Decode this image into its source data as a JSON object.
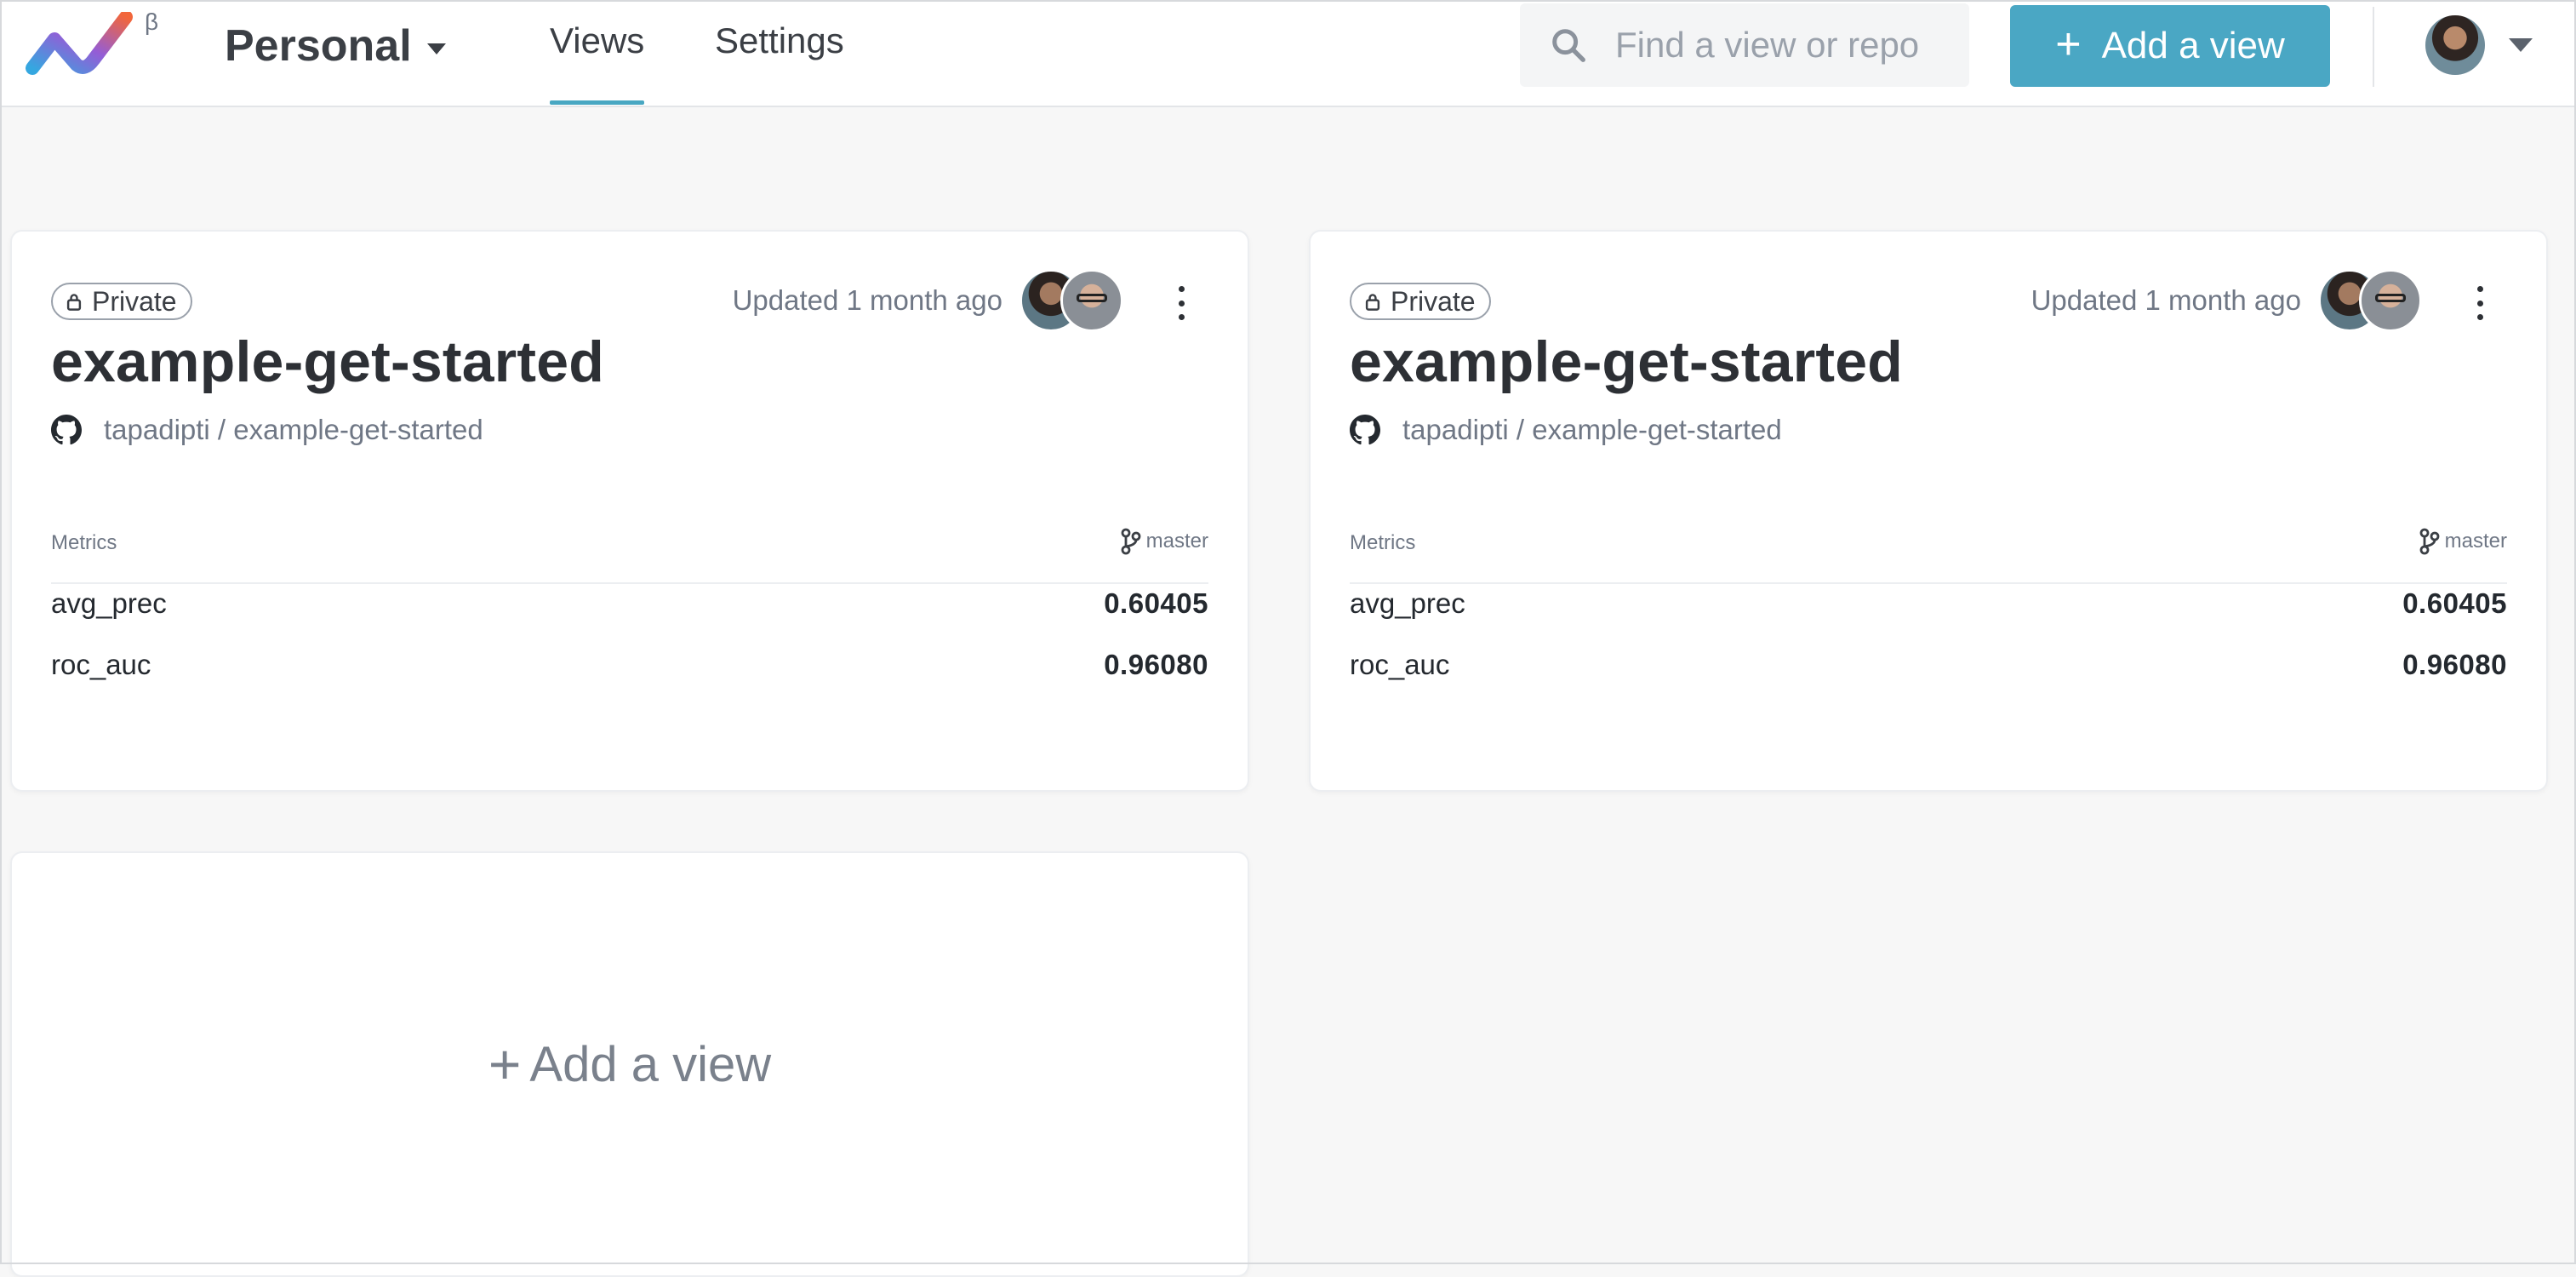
{
  "header": {
    "logo_icon": "dvc-logo-icon",
    "beta_mark": "β",
    "workspace": "Personal",
    "tabs": [
      {
        "label": "Views",
        "active": true
      },
      {
        "label": "Settings",
        "active": false
      }
    ],
    "search": {
      "placeholder": "Find a view or repo",
      "value": ""
    },
    "add_button": {
      "icon": "plus-icon",
      "label": "Add a view"
    },
    "accent_color": "#4aa7c4"
  },
  "cards": [
    {
      "visibility": "Private",
      "updated": "Updated 1 month ago",
      "title": "example-get-started",
      "repo": "tapadipti / example-get-started",
      "metrics_label": "Metrics",
      "branch": "master",
      "metrics": [
        {
          "name": "avg_prec",
          "value": "0.60405"
        },
        {
          "name": "roc_auc",
          "value": "0.96080"
        }
      ]
    },
    {
      "visibility": "Private",
      "updated": "Updated 1 month ago",
      "title": "example-get-started",
      "repo": "tapadipti / example-get-started",
      "metrics_label": "Metrics",
      "branch": "master",
      "metrics": [
        {
          "name": "avg_prec",
          "value": "0.60405"
        },
        {
          "name": "roc_auc",
          "value": "0.96080"
        }
      ]
    }
  ],
  "add_view_card": {
    "plus": "+",
    "label": "Add a view"
  }
}
